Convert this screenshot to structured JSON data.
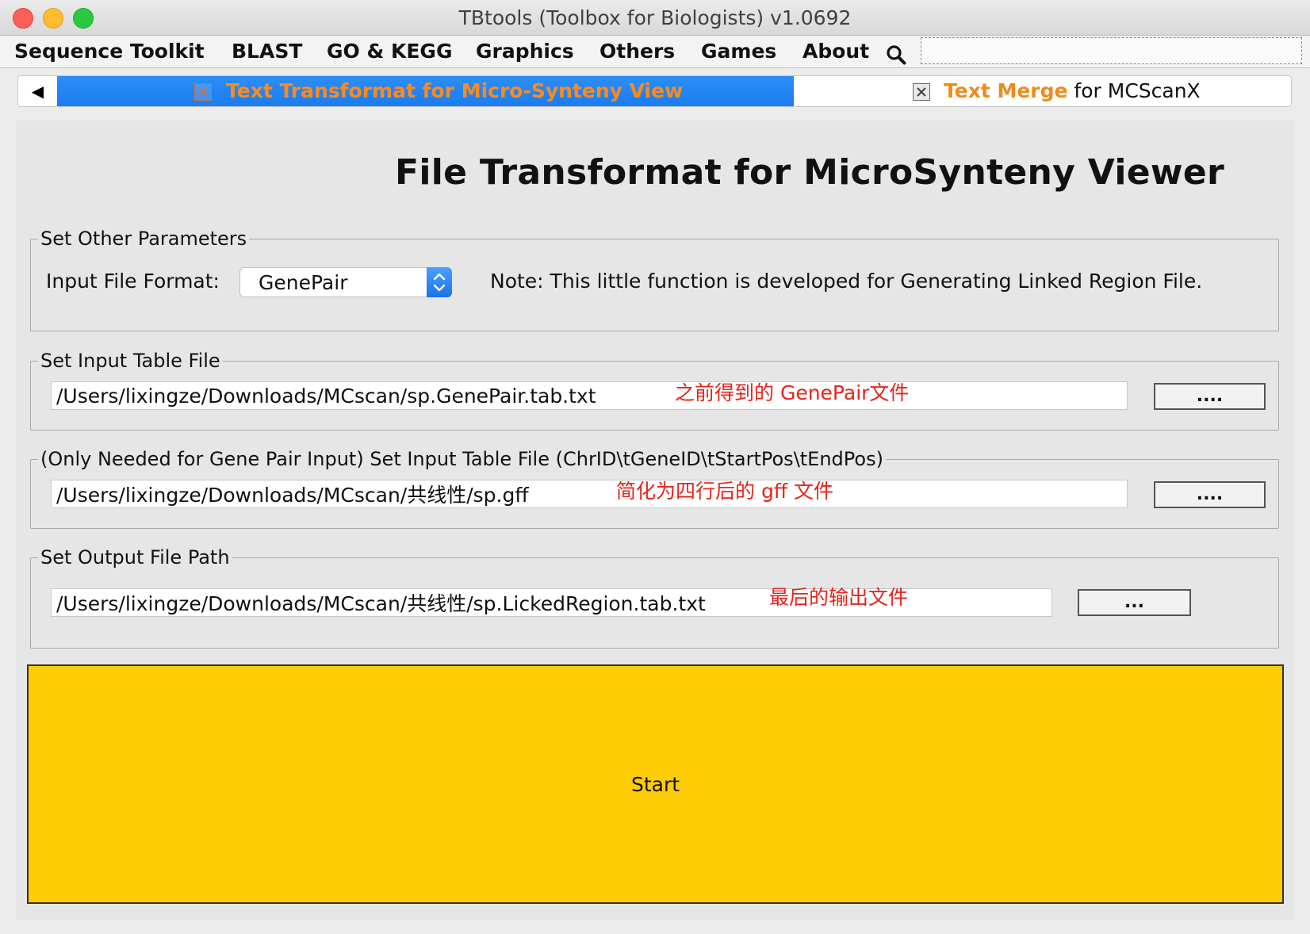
{
  "window": {
    "title": "TBtools (Toolbox for Biologists) v1.0692"
  },
  "menubar": {
    "items": [
      "Sequence Toolkit",
      "BLAST",
      "GO & KEGG",
      "Graphics",
      "Others",
      "Games",
      "About"
    ],
    "search_value": ""
  },
  "tabs": {
    "back_glyph": "◀",
    "active_label": "Text Transformat for Micro-Synteny View",
    "inactive_label_emphasis": "Text Merge",
    "inactive_label_rest": " for MCScanX"
  },
  "page": {
    "heading": "File Transformat for MicroSynteny Viewer"
  },
  "params": {
    "legend": "Set Other Parameters",
    "format_label": "Input File Format:",
    "format_value": "GenePair",
    "note": "Note: This little function is developed for Generating Linked Region File."
  },
  "input_table": {
    "legend": "Set Input Table File",
    "path": "/Users/lixingze/Downloads/MCscan/sp.GenePair.tab.txt",
    "annotation": "之前得到的 GenePair文件",
    "browse_label": "...."
  },
  "gene_pair_input": {
    "legend": "(Only Needed for Gene Pair Input) Set Input Table File (ChrID\\tGeneID\\tStartPos\\tEndPos)",
    "path": "/Users/lixingze/Downloads/MCscan/共线性/sp.gff",
    "annotation": "简化为四行后的 gff 文件",
    "browse_label": "...."
  },
  "output": {
    "legend": "Set Output File Path",
    "path": "/Users/lixingze/Downloads/MCscan/共线性/sp.LickedRegion.tab.txt",
    "annotation": "最后的输出文件",
    "browse_label": "..."
  },
  "actions": {
    "start_label": "Start"
  },
  "colors": {
    "active_tab": "#1a7cf0",
    "tab_text_accent": "#ff8a1c",
    "annotation": "#e8231b",
    "start_button": "#fecc02",
    "select_accent": "#1a73e8"
  }
}
